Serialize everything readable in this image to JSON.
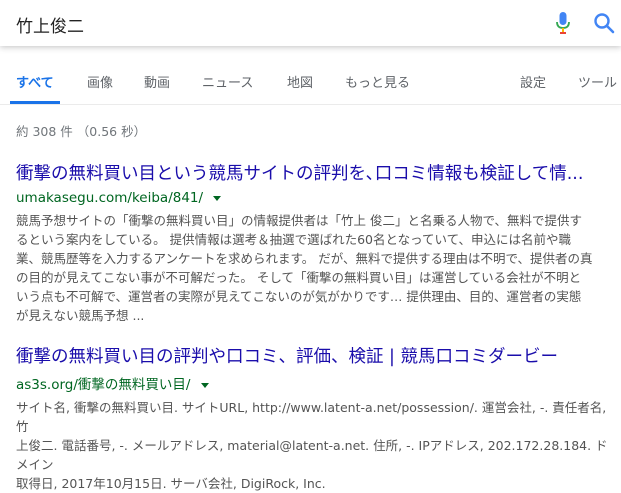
{
  "search": {
    "query": "竹上俊二"
  },
  "tabs": [
    {
      "label": "すべて"
    },
    {
      "label": "画像"
    },
    {
      "label": "動画"
    },
    {
      "label": "ニュース"
    },
    {
      "label": "地図"
    },
    {
      "label": "もっと見る"
    },
    {
      "label": "設定"
    },
    {
      "label": "ツール"
    }
  ],
  "stats": "約 308 件 （0.56 秒）",
  "results": [
    {
      "title": "衝撃の無料買い目という競馬サイトの評判を､口コミ情報も検証して情...",
      "url": "umakasegu.com/keiba/841/",
      "snippet": [
        "競馬予想サイトの「衝撃の無料買い目」の情報提供者は「竹上 俊二」と名乗る人物で、無料で提供す",
        "るという案内をしている。 提供情報は選考＆抽選で選ばれた60名となっていて、申込には名前や職",
        "業、競馬歴等を入力するアンケートを求められます。 だが、無料で提供する理由は不明で、提供者の真",
        "の目的が見えてこない事が不可解だった。 そして「衝撃の無料買い目」は運営している会社が不明と",
        "いう点も不可解で、運営者の実際が見えてこないのが気がかりです… 提供理由、目的、運営者の実態",
        "が見えない競馬予想 ..."
      ]
    },
    {
      "title": "衝撃の無料買い目の評判や口コミ、評価、検証 | 競馬口コミダービー",
      "url": "as3s.org/衝撃の無料買い目/",
      "snippet": [
        "サイト名, 衝撃の無料買い目. サイトURL, http://www.latent-a.net/possession/. 運営会社, -. 責任者名, 竹",
        "上俊二. 電話番号, -. メールアドレス, material@latent-a.net. 住所, -. IPアドレス, 202.172.28.184. ドメイン",
        "取得日, 2017年10月15日. サーバ会社, DigiRock, Inc."
      ]
    }
  ],
  "colors": {
    "link": "#1a0dab",
    "url": "#006621",
    "accent": "#1a73e8"
  }
}
